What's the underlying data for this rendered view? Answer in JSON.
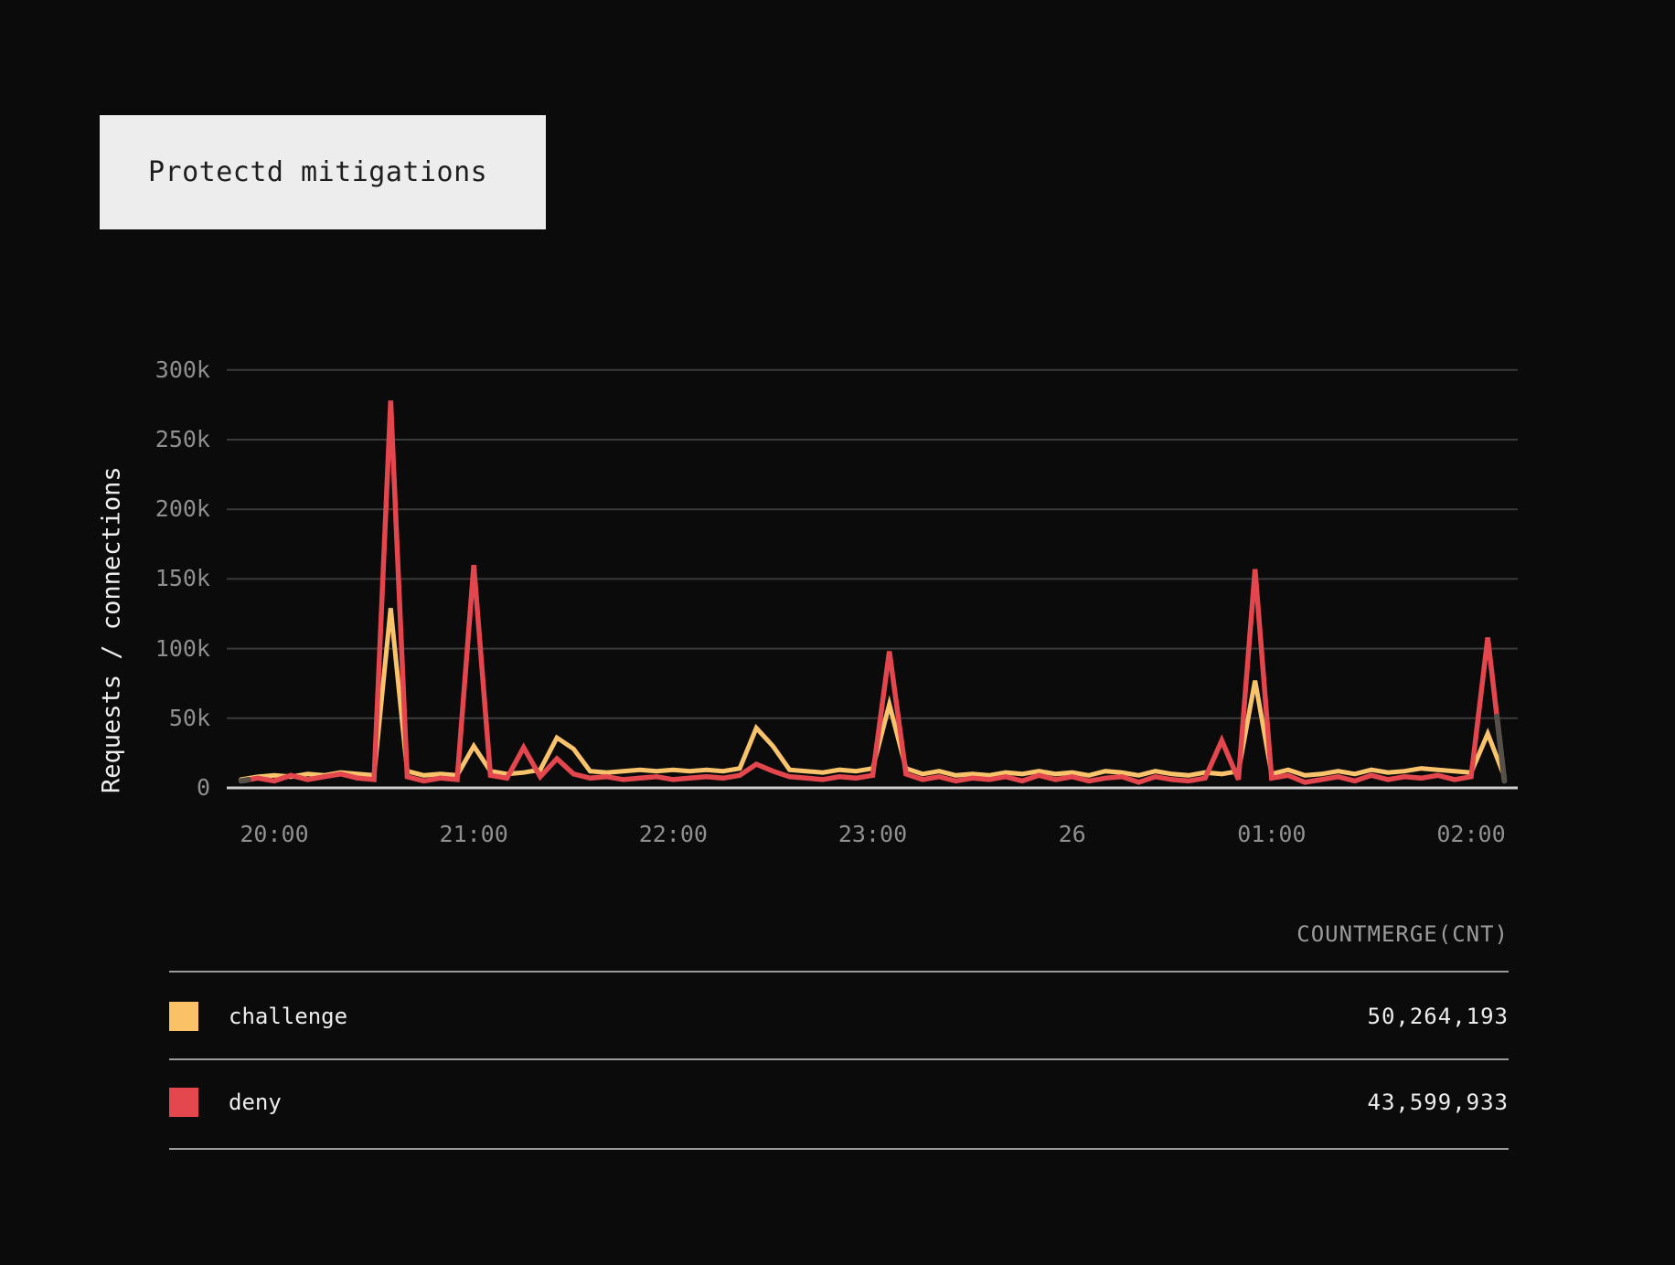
{
  "title": "Protectd mitigations",
  "chart_data": {
    "type": "line",
    "title": "Protectd mitigations",
    "xlabel": "",
    "ylabel": "Requests / connections",
    "ylim": [
      0,
      300000
    ],
    "grid": true,
    "legend_position": "bottom-table",
    "y_ticks": [
      {
        "label": "0",
        "value": 0
      },
      {
        "label": "50k",
        "value": 50000
      },
      {
        "label": "100k",
        "value": 100000
      },
      {
        "label": "150k",
        "value": 150000
      },
      {
        "label": "200k",
        "value": 200000
      },
      {
        "label": "250k",
        "value": 250000
      },
      {
        "label": "300k",
        "value": 300000
      }
    ],
    "x_ticks": [
      {
        "label": "20:00",
        "minutes_from_2000": 0
      },
      {
        "label": "21:00",
        "minutes_from_2000": 60
      },
      {
        "label": "22:00",
        "minutes_from_2000": 120
      },
      {
        "label": "23:00",
        "minutes_from_2000": 180
      },
      {
        "label": "26",
        "minutes_from_2000": 240
      },
      {
        "label": "01:00",
        "minutes_from_2000": 300
      },
      {
        "label": "02:00",
        "minutes_from_2000": 360
      }
    ],
    "time_start_minutes_from_2000": -10,
    "time_step_minutes": 5,
    "edge_stub_color": "#56504a",
    "series": [
      {
        "name": "challenge",
        "color": "#f9c36c",
        "values_thousands": [
          6,
          8,
          9,
          8,
          10,
          9,
          11,
          10,
          9,
          129,
          12,
          9,
          10,
          9,
          30,
          12,
          10,
          11,
          13,
          36,
          28,
          12,
          11,
          12,
          13,
          12,
          13,
          12,
          13,
          12,
          14,
          43,
          30,
          13,
          12,
          11,
          13,
          12,
          14,
          60,
          14,
          10,
          12,
          9,
          10,
          9,
          11,
          10,
          12,
          10,
          11,
          9,
          12,
          11,
          9,
          12,
          10,
          9,
          11,
          10,
          12,
          77,
          10,
          13,
          9,
          10,
          12,
          10,
          13,
          11,
          12,
          14,
          13,
          12,
          11,
          39,
          8
        ]
      },
      {
        "name": "deny",
        "color": "#e3464d",
        "values_thousands": [
          5,
          7,
          5,
          9,
          6,
          8,
          10,
          7,
          6,
          278,
          8,
          5,
          7,
          6,
          160,
          9,
          7,
          29,
          8,
          21,
          10,
          7,
          8,
          6,
          7,
          8,
          6,
          7,
          8,
          7,
          9,
          17,
          12,
          8,
          7,
          6,
          8,
          7,
          9,
          98,
          10,
          6,
          8,
          5,
          7,
          6,
          8,
          5,
          9,
          6,
          8,
          5,
          7,
          8,
          4,
          8,
          6,
          5,
          7,
          34,
          6,
          157,
          7,
          9,
          4,
          6,
          8,
          5,
          9,
          6,
          8,
          7,
          9,
          6,
          8,
          108,
          5
        ]
      }
    ]
  },
  "legend_table": {
    "header": "COUNTMERGE(CNT)",
    "rows": [
      {
        "label": "challenge",
        "swatch_color": "#fac167",
        "value": "50,264,193"
      },
      {
        "label": "deny",
        "swatch_color": "#e5474e",
        "value": "43,599,933"
      }
    ]
  },
  "colors": {
    "background": "#0b0b0b",
    "title_card_bg": "#ededed",
    "gridline": "#3a3a3a",
    "axis_line": "#cfcfcf",
    "tick_text": "#8f8f8f",
    "text": "#ededed"
  }
}
